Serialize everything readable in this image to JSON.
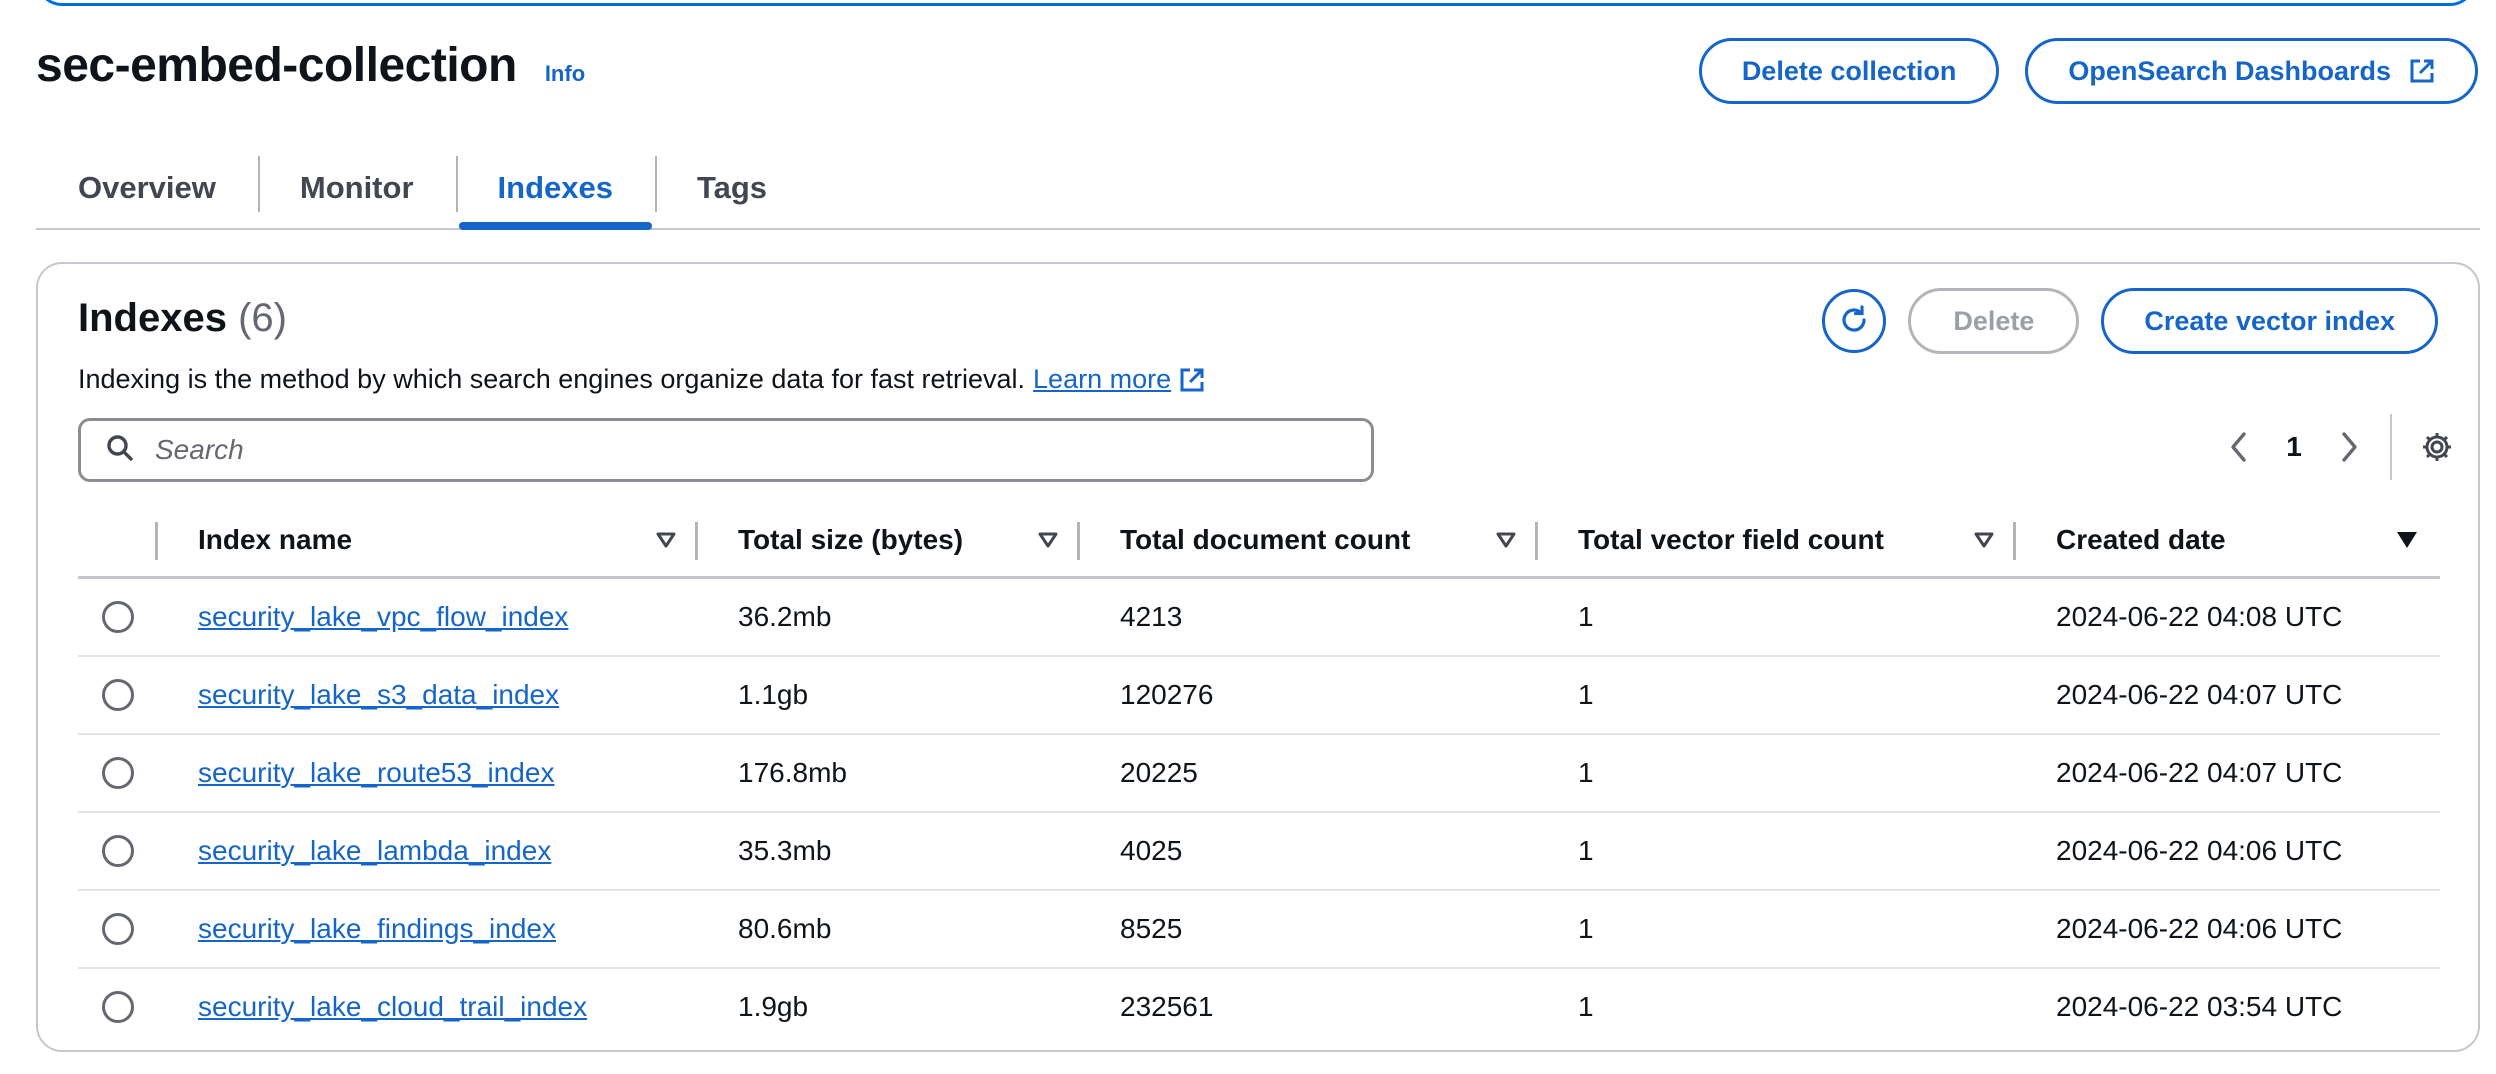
{
  "header": {
    "title": "sec-embed-collection",
    "info_label": "Info",
    "delete_collection_label": "Delete collection",
    "dashboards_label": "OpenSearch Dashboards"
  },
  "tabs": [
    {
      "label": "Overview",
      "active": false
    },
    {
      "label": "Monitor",
      "active": false
    },
    {
      "label": "Indexes",
      "active": true
    },
    {
      "label": "Tags",
      "active": false
    }
  ],
  "panel": {
    "title": "Indexes",
    "count": "(6)",
    "description": "Indexing is the method by which search engines organize data for fast retrieval.",
    "learn_more_label": "Learn more",
    "delete_label": "Delete",
    "create_label": "Create vector index",
    "search_placeholder": "Search",
    "current_page": "1"
  },
  "table": {
    "columns": [
      {
        "label": "Index name",
        "sort": "sortable"
      },
      {
        "label": "Total size (bytes)",
        "sort": "sortable"
      },
      {
        "label": "Total document count",
        "sort": "sortable"
      },
      {
        "label": "Total vector field count",
        "sort": "sortable"
      },
      {
        "label": "Created date",
        "sort": "descending"
      }
    ],
    "rows": [
      {
        "name": "security_lake_vpc_flow_index",
        "size": "36.2mb",
        "docs": "4213",
        "vectors": "1",
        "created": "2024-06-22 04:08 UTC"
      },
      {
        "name": "security_lake_s3_data_index",
        "size": "1.1gb",
        "docs": "120276",
        "vectors": "1",
        "created": "2024-06-22 04:07 UTC"
      },
      {
        "name": "security_lake_route53_index",
        "size": "176.8mb",
        "docs": "20225",
        "vectors": "1",
        "created": "2024-06-22 04:07 UTC"
      },
      {
        "name": "security_lake_lambda_index",
        "size": "35.3mb",
        "docs": "4025",
        "vectors": "1",
        "created": "2024-06-22 04:06 UTC"
      },
      {
        "name": "security_lake_findings_index",
        "size": "80.6mb",
        "docs": "8525",
        "vectors": "1",
        "created": "2024-06-22 04:06 UTC"
      },
      {
        "name": "security_lake_cloud_trail_index",
        "size": "1.9gb",
        "docs": "232561",
        "vectors": "1",
        "created": "2024-06-22 03:54 UTC"
      }
    ]
  },
  "colors": {
    "accent": "#1566c8",
    "text": "#0f141a",
    "muted": "#656871",
    "border": "#c6c6cd",
    "disabled": "#9aa0a8"
  },
  "icons": {
    "external": "external-link-icon",
    "refresh": "refresh-icon",
    "search": "search-icon",
    "prev": "chevron-left-icon",
    "next": "chevron-right-icon",
    "settings": "gear-icon",
    "sort": "sort-triangle-icon"
  }
}
